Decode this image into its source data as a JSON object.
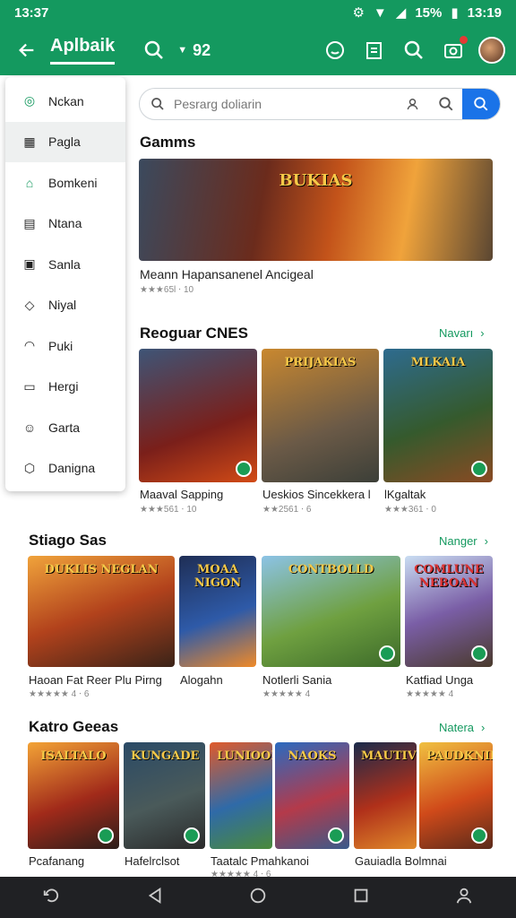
{
  "status_bar": {
    "time": "13:37",
    "battery": "15%",
    "clock": "13:19"
  },
  "app_bar": {
    "title": "Aplbaik",
    "count": "92"
  },
  "side_menu": {
    "items": [
      {
        "label": "Nckan",
        "icon": "circle-plus-icon"
      },
      {
        "label": "Pagla",
        "icon": "grid-icon"
      },
      {
        "label": "Bomkeni",
        "icon": "bookmark-icon"
      },
      {
        "label": "Ntana",
        "icon": "calendar-icon"
      },
      {
        "label": "Sanla",
        "icon": "briefcase-icon"
      },
      {
        "label": "Niyal",
        "icon": "drop-icon"
      },
      {
        "label": "Puki",
        "icon": "headphones-icon"
      },
      {
        "label": "Hergi",
        "icon": "ticket-icon"
      },
      {
        "label": "Garta",
        "icon": "face-icon"
      },
      {
        "label": "Danigna",
        "icon": "shield-icon"
      }
    ]
  },
  "search": {
    "placeholder": "Pesrarg doliarin"
  },
  "games": {
    "title": "Gamms",
    "featured": {
      "caption": "Meann Hapansanenel Ancigeal",
      "meta": "★★★65l ⋅ 10"
    }
  },
  "popular": {
    "title": "Reoguar CNES",
    "more": "Navarı",
    "items": [
      {
        "caption": "Maaval Sapping",
        "meta": "★★★561 ⋅ 10"
      },
      {
        "caption": "Ueskios Sincekkera l",
        "meta": "★★2561 ⋅ 6"
      },
      {
        "caption": "lKgaltak",
        "meta": "★★★361 ⋅ 0"
      }
    ]
  },
  "strategy": {
    "title": "Stiago Sas",
    "more": "Nanger",
    "items": [
      {
        "caption": "Haoan Fat Reer Plu Pirng",
        "meta": "★★★★★ 4 ⋅ 6"
      },
      {
        "caption": "Alogahn",
        "meta": ""
      },
      {
        "caption": "Notlerli Sania",
        "meta": "★★★★★ 4"
      },
      {
        "caption": "Katfiad Unga",
        "meta": "★★★★★ 4"
      }
    ]
  },
  "katro": {
    "title": "Katro Geeas",
    "more": "Natera",
    "items": [
      {
        "caption": "Pcafanang",
        "meta": ""
      },
      {
        "caption": "Hafelrclsot",
        "meta": ""
      },
      {
        "caption": "Taatalc Pmahkanoi",
        "meta": "★★★★★ 4 ⋅ 6"
      },
      {
        "caption": "",
        "meta": ""
      },
      {
        "caption": "Gauiadla Bolmnai",
        "meta": ""
      },
      {
        "caption": "",
        "meta": ""
      }
    ]
  },
  "tile_titles": {
    "featured": "BUKIAS",
    "p1": "",
    "p2": "PRIJAKIAS",
    "p3": "MLKAIA",
    "s1": "DUKLIS NEGLAN",
    "s2": "MOAA NIGON",
    "s3": "CONTBOLLD",
    "s4": "COMLUNE NEBOAN",
    "k1": "ISALTALO",
    "k2": "KUNGADE",
    "k3": "LUNIOOER",
    "k4": "NAOKS",
    "k5": "MAUTIVRE",
    "k6": "PAUDKNIB"
  },
  "colors": {
    "brand": "#14995f",
    "accent": "#1a73e8"
  }
}
